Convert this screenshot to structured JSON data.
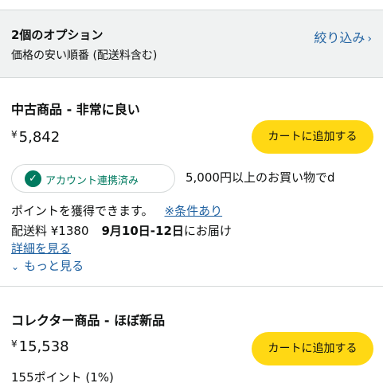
{
  "header": {
    "option_count": "2個のオプション",
    "sort_order": "価格の安い順番 (配送料含む)",
    "filter_label": "絞り込み",
    "filter_icon": "chevron-right-icon"
  },
  "offers": [
    {
      "condition": "中古商品 - 非常に良い",
      "currency": "¥",
      "price": "5,842",
      "cart_label": "カートに追加する",
      "account_badge": "アカウント連携済み",
      "promo_text": "5,000円以上のお買い物でd",
      "points_text": "ポイントを獲得できます。",
      "conditions_link": "※条件あり",
      "shipping_fee": "配送料 ¥1380",
      "delivery_date": "9月10日-12日",
      "delivery_suffix": "にお届け",
      "details_link": "詳細を見る",
      "more_link": "もっと見る"
    },
    {
      "condition": "コレクター商品 - ほぼ新品",
      "currency": "¥",
      "price": "15,538",
      "cart_label": "カートに追加する",
      "points": "155ポイント (1%)"
    }
  ],
  "colors": {
    "link": "#2162a1",
    "cart_button": "#ffd814",
    "badge_green": "#007a5f"
  }
}
